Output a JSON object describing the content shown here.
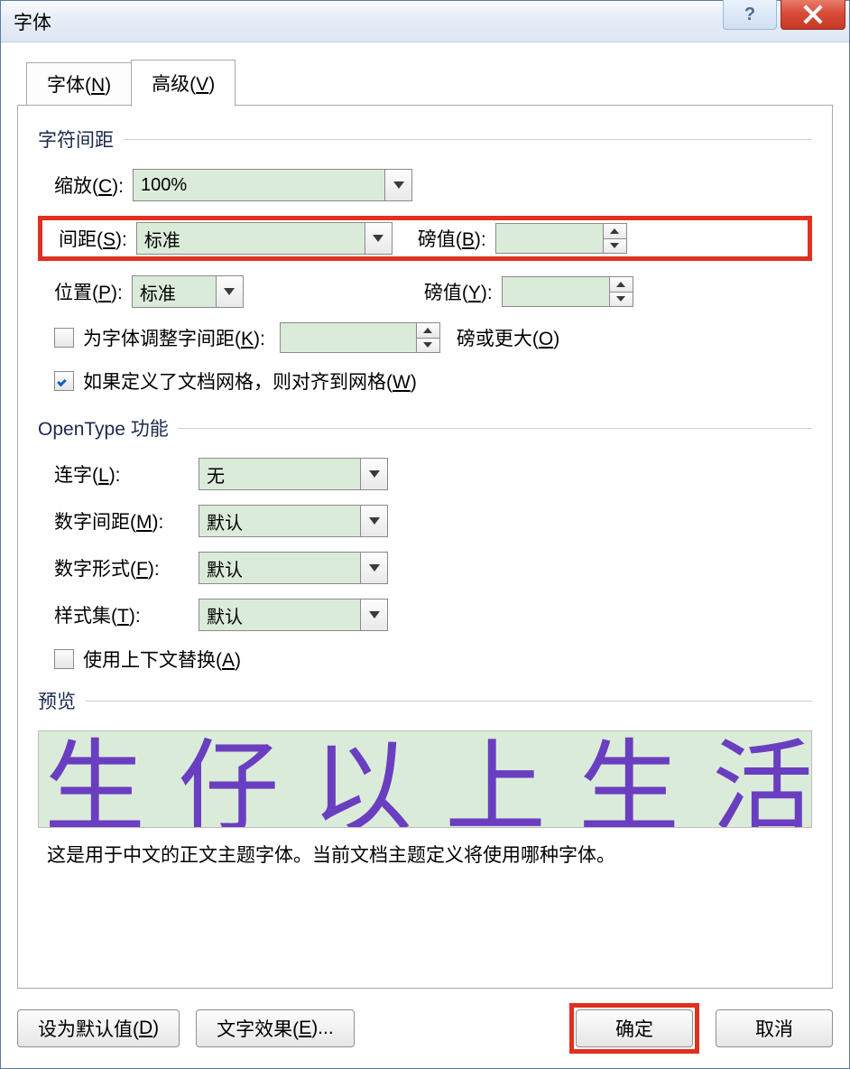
{
  "titlebar": {
    "title": "字体"
  },
  "tabs": {
    "font": {
      "pre": "字体(",
      "key": "N",
      "post": ")"
    },
    "advanced": {
      "pre": "高级(",
      "key": "V",
      "post": ")"
    }
  },
  "spacing_group": {
    "header": "字符间距",
    "scale": {
      "pre": "缩放(",
      "key": "C",
      "post": "):",
      "value": "100%"
    },
    "spacing": {
      "pre": "间距(",
      "key": "S",
      "post": "):",
      "value": "标准",
      "pt_pre": "磅值(",
      "pt_key": "B",
      "pt_post": "):",
      "pt_value": ""
    },
    "position": {
      "pre": "位置(",
      "key": "P",
      "post": "):",
      "value": "标准",
      "pt_pre": "磅值(",
      "pt_key": "Y",
      "pt_post": "):",
      "pt_value": ""
    },
    "kerning": {
      "checked": false,
      "pre": "为字体调整字间距(",
      "key": "K",
      "post": "):",
      "value": "",
      "suffix_pre": "磅或更大(",
      "suffix_key": "O",
      "suffix_post": ")"
    },
    "snap": {
      "checked": true,
      "pre": "如果定义了文档网格，则对齐到网格(",
      "key": "W",
      "post": ")"
    }
  },
  "opentype_group": {
    "header": "OpenType 功能",
    "ligatures": {
      "pre": "连字(",
      "key": "L",
      "post": "):",
      "value": "无"
    },
    "numspacing": {
      "pre": "数字间距(",
      "key": "M",
      "post": "):",
      "value": "默认"
    },
    "numforms": {
      "pre": "数字形式(",
      "key": "F",
      "post": "):",
      "value": "默认"
    },
    "styleset": {
      "pre": "样式集(",
      "key": "T",
      "post": "):",
      "value": "默认"
    },
    "contextual": {
      "checked": false,
      "pre": "使用上下文替换(",
      "key": "A",
      "post": ")"
    }
  },
  "preview": {
    "header": "预览",
    "sample": "生仔以上生活以",
    "description": "这是用于中文的正文主题字体。当前文档主题定义将使用哪种字体。"
  },
  "footer": {
    "default": {
      "pre": "设为默认值(",
      "key": "D",
      "post": ")"
    },
    "effects": {
      "pre": "文字效果(",
      "key": "E",
      "post": ")..."
    },
    "ok": "确定",
    "cancel": "取消"
  }
}
